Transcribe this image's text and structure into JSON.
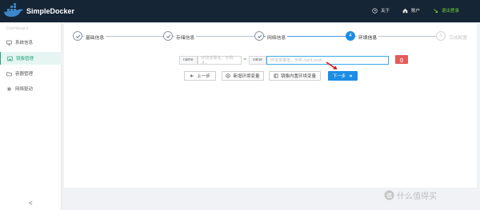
{
  "app": {
    "name": "SimpleDocker"
  },
  "topnav": {
    "about": "关于",
    "account": "账户",
    "logout": "退出登录"
  },
  "sidebar": {
    "items": [
      {
        "label": "Dashboard",
        "state": "dim"
      },
      {
        "label": "系统信息",
        "state": "normal"
      },
      {
        "label": "镜像管理",
        "state": "active"
      },
      {
        "label": "容器管理",
        "state": "normal"
      },
      {
        "label": "网络驱动",
        "state": "normal"
      }
    ],
    "collapse": "<"
  },
  "steps": [
    {
      "label": "基础信息",
      "state": "done"
    },
    {
      "label": "存储信息",
      "state": "done"
    },
    {
      "label": "网络信息",
      "state": "done"
    },
    {
      "label": "环境信息",
      "state": "current",
      "number": "4"
    },
    {
      "label": "完成配置",
      "state": "wait",
      "number": "5"
    }
  ],
  "env": {
    "name_addon": "name",
    "name_placeholder": "环境变量名，示例 JI...",
    "eq": "=",
    "value_addon": "value",
    "value_placeholder": "环境变量值，示例 /usr/Local/..."
  },
  "buttons": {
    "prev": "上一步",
    "add_env": "新增环境变量",
    "builtin_env": "镜像内置环境变量",
    "next": "下一步"
  },
  "colors": {
    "topbar": "#162535",
    "accent": "#29a37f",
    "primary": "#1c8de4",
    "danger": "#e45b5b"
  },
  "watermark": "什么值得买"
}
